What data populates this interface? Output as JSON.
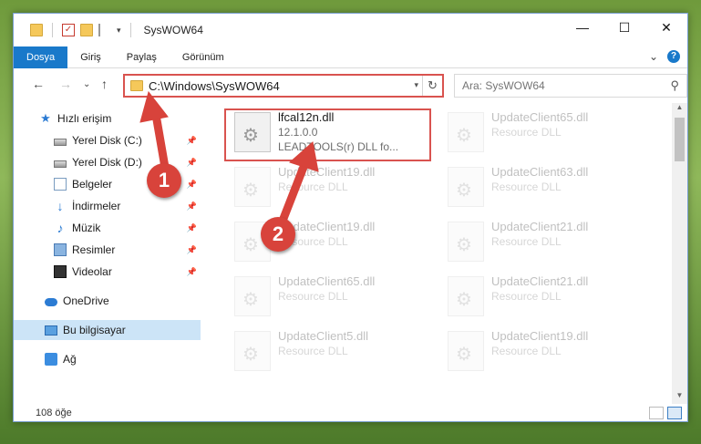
{
  "window": {
    "title": "SysWOW64",
    "controls": {
      "minimize": "—",
      "maximize": "☐",
      "close": "✕"
    }
  },
  "ribbon": {
    "tabs": [
      {
        "label": "Dosya"
      },
      {
        "label": "Giriş"
      },
      {
        "label": "Paylaş"
      },
      {
        "label": "Görünüm"
      }
    ],
    "expand_glyph": "⌄",
    "help_glyph": "?"
  },
  "navbar": {
    "back": "←",
    "forward": "→",
    "recent": "⌄",
    "up": "↑",
    "address": "C:\\Windows\\SysWOW64",
    "address_dropdown": "▾",
    "refresh": "↻",
    "search_placeholder": "Ara: SysWOW64",
    "search_glyph": "⚲"
  },
  "sidebar": {
    "items": [
      {
        "label": "Hızlı erişim",
        "icon": "star-icon"
      },
      {
        "label": "Yerel Disk (C:)",
        "icon": "disk-icon",
        "pinned": true
      },
      {
        "label": "Yerel Disk (D:)",
        "icon": "disk-icon",
        "pinned": true
      },
      {
        "label": "Belgeler",
        "icon": "documents-icon",
        "pinned": true
      },
      {
        "label": "İndirmeler",
        "icon": "download-icon",
        "pinned": true
      },
      {
        "label": "Müzik",
        "icon": "music-icon",
        "pinned": true
      },
      {
        "label": "Resimler",
        "icon": "pictures-icon",
        "pinned": true
      },
      {
        "label": "Videolar",
        "icon": "videos-icon",
        "pinned": true
      },
      {
        "label": "OneDrive",
        "icon": "onedrive-icon"
      },
      {
        "label": "Bu bilgisayar",
        "icon": "computer-icon",
        "selected": true
      },
      {
        "label": "Ağ",
        "icon": "network-icon"
      }
    ],
    "pin_glyph": "📌"
  },
  "files": {
    "highlighted": {
      "name": "lfcal12n.dll",
      "version": "12.1.0.0",
      "description": "LEADTOOLS(r) DLL fo..."
    },
    "faded": [
      {
        "name": "UpdateClient65.dll",
        "type": "Resource DLL"
      },
      {
        "name": "UpdateClient19.dll",
        "type": "Resource DLL"
      },
      {
        "name": "UpdateClient63.dll",
        "type": "Resource DLL"
      },
      {
        "name": "UpdateClient19.dll",
        "type": "Resource DLL"
      },
      {
        "name": "UpdateClient21.dll",
        "type": "Resource DLL"
      },
      {
        "name": "UpdateClient65.dll",
        "type": "Resource DLL"
      },
      {
        "name": "UpdateClient21.dll",
        "type": "Resource DLL"
      },
      {
        "name": "UpdateClient5.dll",
        "type": "Resource DLL"
      },
      {
        "name": "UpdateClient19.dll",
        "type": "Resource DLL"
      }
    ]
  },
  "status": {
    "item_count": "108 öğe"
  },
  "annotations": {
    "markers": [
      {
        "label": "1"
      },
      {
        "label": "2"
      }
    ],
    "color": "#d8433b"
  }
}
